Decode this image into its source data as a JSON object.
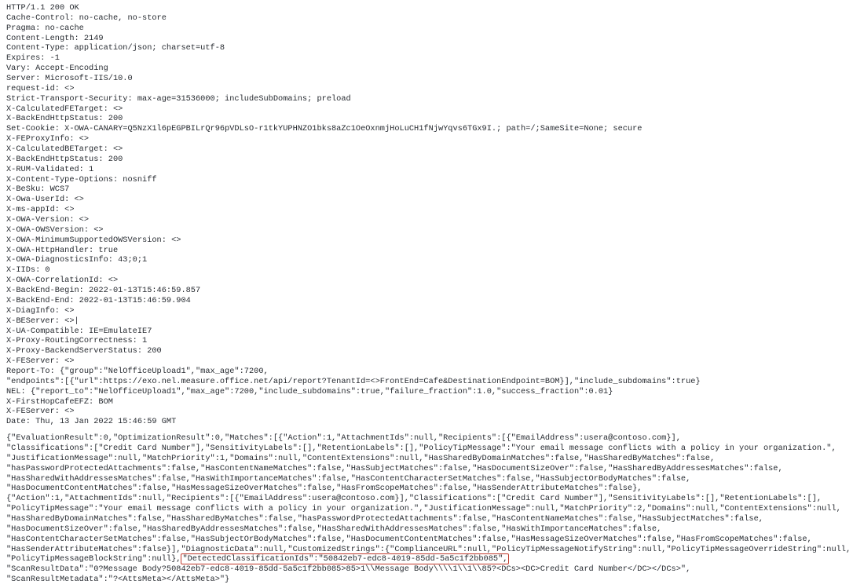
{
  "headers": [
    "HTTP/1.1 200 OK",
    "Cache-Control: no-cache, no-store",
    "Pragma: no-cache",
    "Content-Length: 2149",
    "Content-Type: application/json; charset=utf-8",
    "Expires: -1",
    "Vary: Accept-Encoding",
    "Server: Microsoft-IIS/10.0",
    "request-id: <>",
    "Strict-Transport-Security: max-age=31536000; includeSubDomains; preload",
    "X-CalculatedFETarget: <>",
    "X-BackEndHttpStatus: 200",
    "Set-Cookie: X-OWA-CANARY=Q5NzX1l6pEGPBILrQr96pVDLsO-r1tkYUPHNZO1bks8aZc1OeOxnmjHoLuCH1fNjwYqvs6TGx9I.; path=/;SameSite=None; secure",
    "X-FEProxyInfo: <>",
    "X-CalculatedBETarget: <>",
    "X-BackEndHttpStatus: 200",
    "X-RUM-Validated: 1",
    "X-Content-Type-Options: nosniff",
    "X-BeSku: WCS7",
    "X-Owa-UserId: <>",
    "X-ms-appId: <>",
    "X-OWA-Version: <>",
    "X-OWA-OWSVersion: <>",
    "X-OWA-MinimumSupportedOWSVersion: <>",
    "X-OWA-HttpHandler: true",
    "X-OWA-DiagnosticsInfo: 43;0;1",
    "X-IIDs: 0",
    "X-OWA-CorrelationId: <>",
    "X-BackEnd-Begin: 2022-01-13T15:46:59.857",
    "X-BackEnd-End: 2022-01-13T15:46:59.904",
    "X-DiagInfo: <>",
    "X-BEServer: <>|",
    "X-UA-Compatible: IE=EmulateIE7",
    "X-Proxy-RoutingCorrectness: 1",
    "X-Proxy-BackendServerStatus: 200",
    "X-FEServer: <>",
    "Report-To: {\"group\":\"NelOfficeUpload1\",\"max_age\":7200,",
    "\"endpoints\":[{\"url\":https://exo.nel.measure.office.net/api/report?TenantId=<>FrontEnd=Cafe&DestinationEndpoint=BOM}],\"include_subdomains\":true}",
    "NEL: {\"report_to\":\"NelOfficeUpload1\",\"max_age\":7200,\"include_subdomains\":true,\"failure_fraction\":1.0,\"success_fraction\":0.01}",
    "X-FirstHopCafeEFZ: BOM",
    "X-FEServer: <>",
    "Date: Thu, 13 Jan 2022 15:46:59 GMT"
  ],
  "body_pre": [
    "{\"EvaluationResult\":0,\"OptimizationResult\":0,\"Matches\":[{\"Action\":1,\"AttachmentIds\":null,\"Recipients\":[{\"EmailAddress\":usera@contoso.com}],",
    "\"Classifications\":[\"Credit Card Number\"],\"SensitivityLabels\":[],\"RetentionLabels\":[],\"PolicyTipMessage\":\"Your email message conflicts with a policy in your organization.\",",
    "\"JustificationMessage\":null,\"MatchPriority\":1,\"Domains\":null,\"ContentExtensions\":null,\"HasSharedByDomainMatches\":false,\"HasSharedByMatches\":false,",
    "\"hasPasswordProtectedAttachments\":false,\"HasContentNameMatches\":false,\"HasSubjectMatches\":false,\"HasDocumentSizeOver\":false,\"HasSharedByAddressesMatches\":false,",
    "\"HasSharedWithAddressesMatches\":false,\"HasWithImportanceMatches\":false,\"HasContentCharacterSetMatches\":false,\"HasSubjectOrBodyMatches\":false,",
    "\"HasDocumentContentMatches\":false,\"HasMessageSizeOverMatches\":false,\"HasFromScopeMatches\":false,\"HasSenderAttributeMatches\":false},",
    "{\"Action\":1,\"AttachmentIds\":null,\"Recipients\":[{\"EmailAddress\":usera@contoso.com}],\"Classifications\":[\"Credit Card Number\"],\"SensitivityLabels\":[],\"RetentionLabels\":[],",
    "\"PolicyTipMessage\":\"Your email message conflicts with a policy in your organization.\",\"JustificationMessage\":null,\"MatchPriority\":2,\"Domains\":null,\"ContentExtensions\":null,",
    "\"HasSharedByDomainMatches\":false,\"HasSharedByMatches\":false,\"hasPasswordProtectedAttachments\":false,\"HasContentNameMatches\":false,\"HasSubjectMatches\":false,",
    "\"HasDocumentSizeOver\":false,\"HasSharedByAddressesMatches\":false,\"HasSharedWithAddressesMatches\":false,\"HasWithImportanceMatches\":false,",
    "\"HasContentCharacterSetMatches\":false,\"HasSubjectOrBodyMatches\":false,\"HasDocumentContentMatches\":false,\"HasMessageSizeOverMatches\":false,\"HasFromScopeMatches\":false,",
    "\"HasSenderAttributeMatches\":false}],\"DiagnosticData\":null,\"CustomizedStrings\":{\"ComplianceURL\":null,\"PolicyTipMessageNotifyString\":null,\"PolicyTipMessageOverrideString\":null,",
    "\"PolicyTipMessageBlockString\":null},"
  ],
  "highlight": "\"DetectedClassificationIds\":\"50842eb7-edc8-4019-85dd-5a5c1f2bb085\",",
  "body_post": [
    "",
    "\"ScanResultData\":\"0?Message Body?50842eb7-edc8-4019-85dd-5a5c1f2bb085>85>1\\\\Message Body\\\\\\\\1\\\\1\\\\85?<DCs><DC>Credit Card Number</DC></DCs>\",",
    "\"ScanResultMetadata\":\"?<AttsMeta></AttsMeta>\"}"
  ]
}
